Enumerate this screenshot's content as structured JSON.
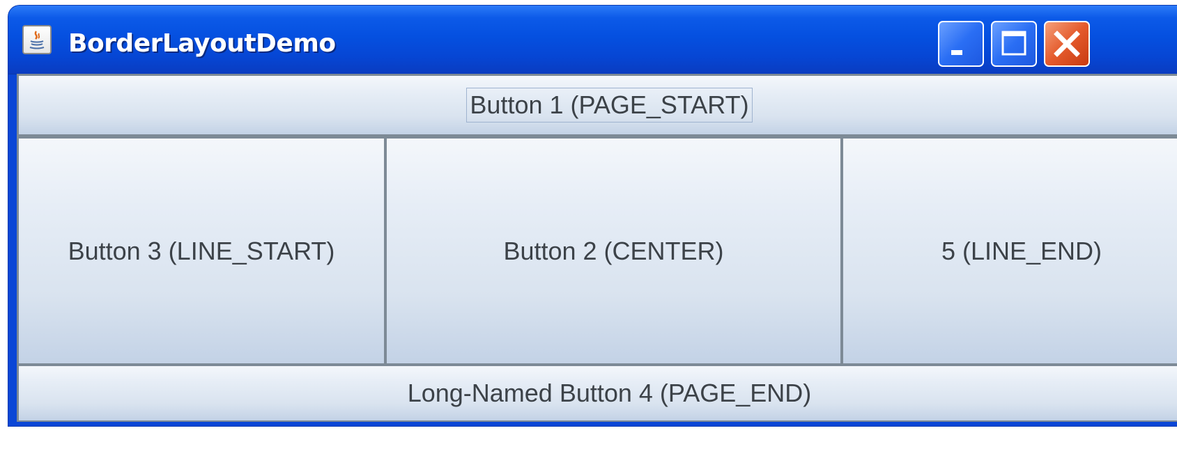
{
  "window": {
    "title": "BorderLayoutDemo",
    "icon": "java-icon"
  },
  "titlebar_buttons": {
    "minimize": "minimize-icon",
    "maximize": "maximize-icon",
    "close": "close-icon"
  },
  "buttons": {
    "page_start": "Button 1 (PAGE_START)",
    "line_start": "Button 3 (LINE_START)",
    "center": "Button 2 (CENTER)",
    "line_end": "5 (LINE_END)",
    "page_end": "Long-Named Button 4 (PAGE_END)"
  },
  "colors": {
    "titlebar": "#0550e0",
    "close_button": "#e45a2c",
    "button_text": "#3c4248",
    "divider": "#7d8a96"
  }
}
